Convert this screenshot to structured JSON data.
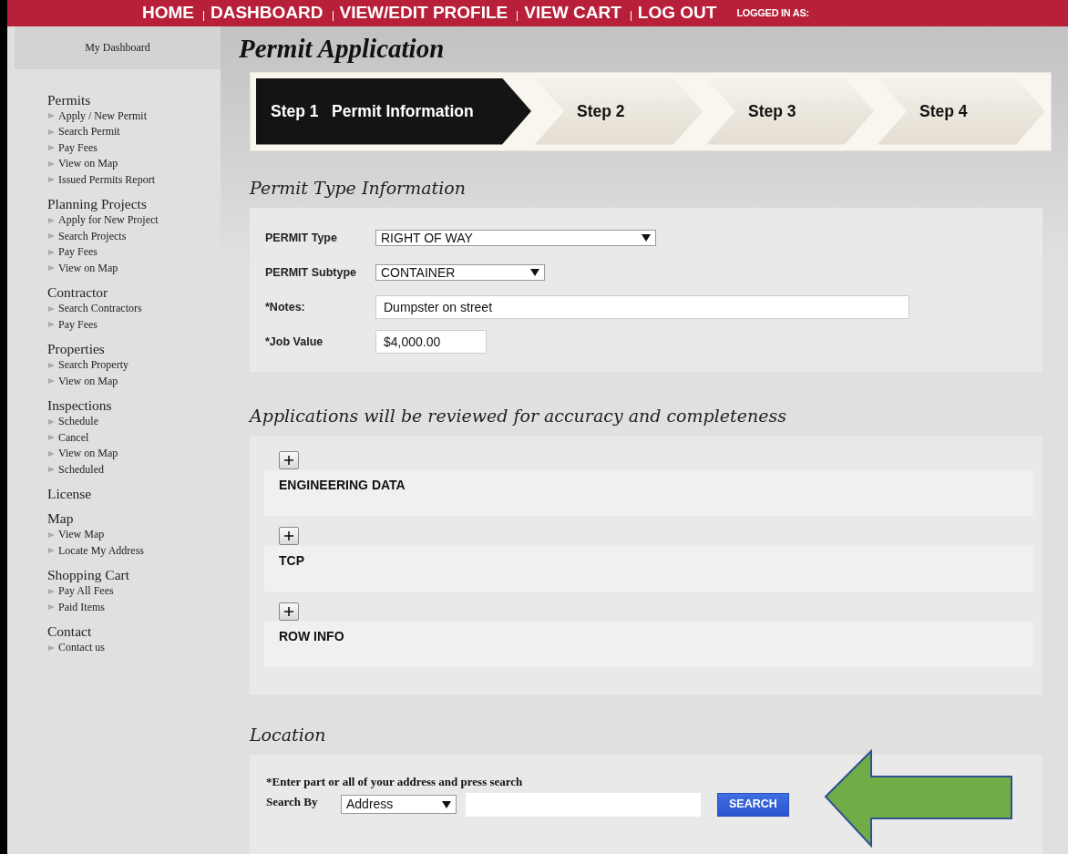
{
  "top_nav": {
    "links": [
      "HOME",
      "DASHBOARD",
      "VIEW/EDIT PROFILE",
      "VIEW CART",
      "LOG OUT"
    ],
    "logged_in_label": "LOGGED IN AS:"
  },
  "sidebar": {
    "dashboard": "My Dashboard",
    "groups": [
      {
        "title": "Permits",
        "items": [
          "Apply / New Permit",
          "Search Permit",
          "Pay Fees",
          "View on Map",
          "Issued Permits Report"
        ]
      },
      {
        "title": "Planning Projects",
        "items": [
          "Apply for New Project",
          "Search Projects",
          "Pay Fees",
          "View on Map"
        ]
      },
      {
        "title": "Contractor",
        "items": [
          "Search Contractors",
          "Pay Fees"
        ]
      },
      {
        "title": "Properties",
        "items": [
          "Search Property",
          "View on Map"
        ]
      },
      {
        "title": "Inspections",
        "items": [
          "Schedule",
          "Cancel",
          "View on Map",
          "Scheduled"
        ]
      },
      {
        "title": "License"
      },
      {
        "title": "Map",
        "items": [
          "View Map",
          "Locate My Address"
        ]
      },
      {
        "title": "Shopping Cart",
        "items": [
          "Pay All Fees",
          "Paid Items"
        ]
      },
      {
        "title": "Contact",
        "items": [
          "Contact us"
        ]
      }
    ]
  },
  "page_title": "Permit Application",
  "steps": [
    {
      "label": "Step 1",
      "title": "Permit Information",
      "selected": true
    },
    {
      "label": "Step 2",
      "selected": false
    },
    {
      "label": "Step 3",
      "selected": false
    },
    {
      "label": "Step 4",
      "selected": false
    }
  ],
  "permit_type_section": {
    "heading": "Permit Type Information",
    "fields": [
      {
        "kind": "select",
        "label": "PERMIT Type",
        "value": "RIGHT OF WAY"
      },
      {
        "kind": "select",
        "label": "PERMIT Subtype",
        "value": "CONTAINER"
      },
      {
        "kind": "text",
        "label": "*Notes:",
        "value": "Dumpster on street"
      },
      {
        "kind": "text",
        "label": "*Job Value",
        "value": "$4,000.00"
      }
    ]
  },
  "review_section": {
    "heading": "Applications will be reviewed for accuracy and completeness",
    "panels": [
      {
        "title": "ENGINEERING DATA",
        "expanded": false
      },
      {
        "title": "TCP",
        "expanded": false
      },
      {
        "title": "ROW INFO",
        "expanded": false
      }
    ]
  },
  "location_section": {
    "heading": "Location",
    "instruction": "*Enter part or all of your address and press search",
    "search_by_label": "Search By",
    "search_by_value": "Address",
    "search_button": "SEARCH"
  }
}
